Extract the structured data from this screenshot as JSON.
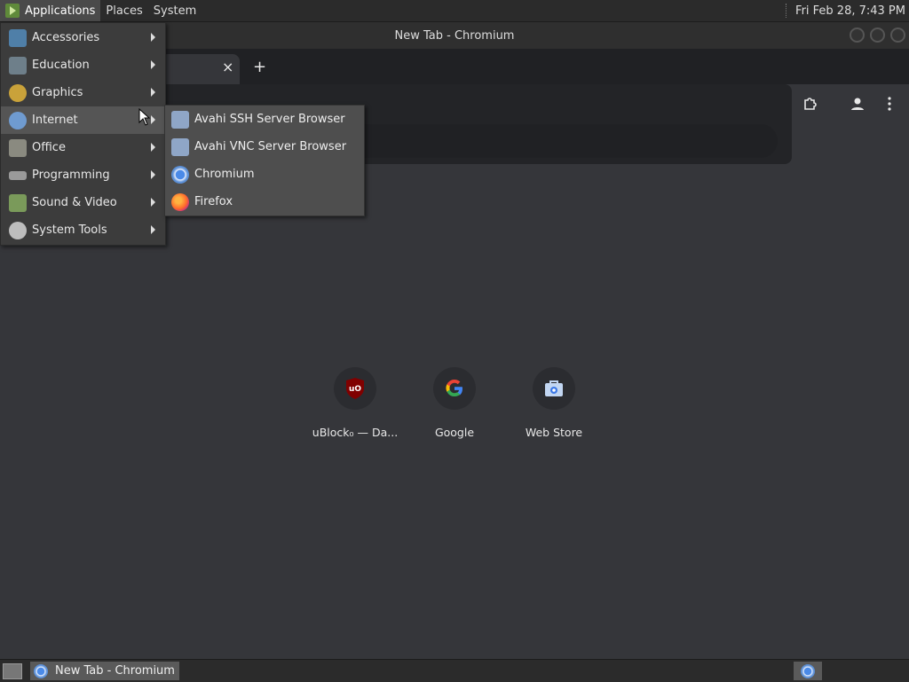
{
  "top_panel": {
    "menus": [
      "Applications",
      "Places",
      "System"
    ],
    "clock": "Fri Feb 28,  7:43 PM"
  },
  "window": {
    "title": "New Tab - Chromium",
    "tab_close": "×",
    "new_tab": "+"
  },
  "apps_menu": {
    "items": [
      {
        "label": "Accessories",
        "icon": "accessories-icon"
      },
      {
        "label": "Education",
        "icon": "education-icon"
      },
      {
        "label": "Graphics",
        "icon": "graphics-icon"
      },
      {
        "label": "Internet",
        "icon": "internet-icon"
      },
      {
        "label": "Office",
        "icon": "office-icon"
      },
      {
        "label": "Programming",
        "icon": "programming-icon"
      },
      {
        "label": "Sound & Video",
        "icon": "sound-video-icon"
      },
      {
        "label": "System Tools",
        "icon": "system-tools-icon"
      }
    ],
    "hovered": "Internet"
  },
  "internet_submenu": {
    "items": [
      {
        "label": "Avahi SSH Server Browser",
        "icon": "avahi-ssh-icon"
      },
      {
        "label": "Avahi VNC Server Browser",
        "icon": "avahi-vnc-icon"
      },
      {
        "label": "Chromium",
        "icon": "chromium-icon"
      },
      {
        "label": "Firefox",
        "icon": "firefox-icon"
      }
    ]
  },
  "shortcuts": [
    {
      "label": "uBlock₀ — Da...",
      "icon": "ublock-icon"
    },
    {
      "label": "Google",
      "icon": "google-icon"
    },
    {
      "label": "Web Store",
      "icon": "webstore-icon"
    }
  ],
  "bottom_panel": {
    "task_label": "New Tab - Chromium"
  }
}
